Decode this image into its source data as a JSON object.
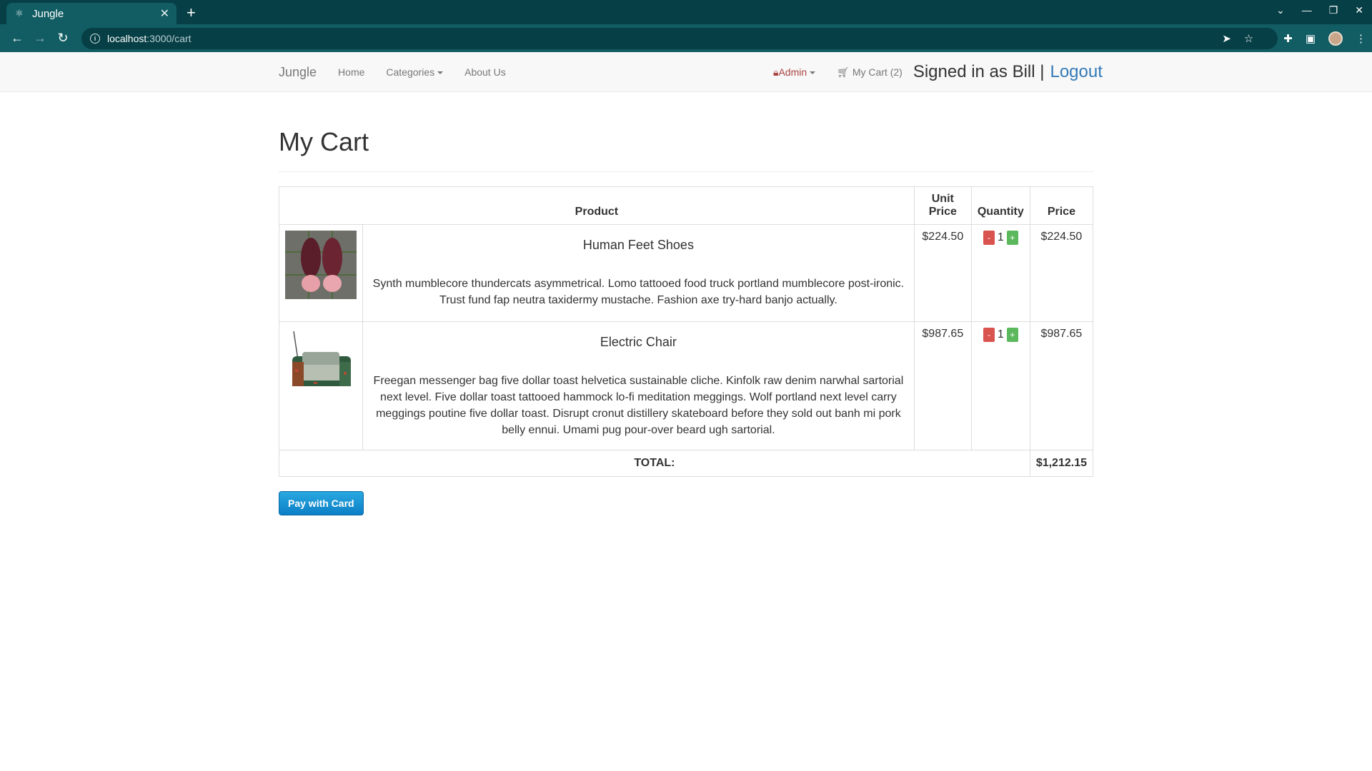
{
  "browser": {
    "tab_title": "Jungle",
    "url_host": "localhost",
    "url_path": ":3000/cart"
  },
  "navbar": {
    "brand": "Jungle",
    "links": [
      "Home",
      "Categories",
      "About Us"
    ],
    "admin": "Admin",
    "cart": "My Cart (2)",
    "signed_in": "Signed in as Bill |",
    "logout": "Logout"
  },
  "page": {
    "title": "My Cart"
  },
  "table": {
    "headers": {
      "product": "Product",
      "unit_price": "Unit Price",
      "quantity": "Quantity",
      "price": "Price"
    },
    "rows": [
      {
        "name": "Human Feet Shoes",
        "description": "Synth mumblecore thundercats asymmetrical. Lomo tattooed food truck portland mumblecore post-ironic. Trust fund fap neutra taxidermy mustache. Fashion axe try-hard banjo actually.",
        "unit_price": "$224.50",
        "quantity": "1",
        "price": "$224.50"
      },
      {
        "name": "Electric Chair",
        "description": "Freegan messenger bag five dollar toast helvetica sustainable cliche. Kinfolk raw denim narwhal sartorial next level. Five dollar toast tattooed hammock lo-fi meditation meggings. Wolf portland next level carry meggings poutine five dollar toast. Disrupt cronut distillery skateboard before they sold out banh mi pork belly ennui. Umami pug pour-over beard ugh sartorial.",
        "unit_price": "$987.65",
        "quantity": "1",
        "price": "$987.65"
      }
    ],
    "total_label": "TOTAL:",
    "total_value": "$1,212.15",
    "minus": "-",
    "plus": "+"
  },
  "pay_button": "Pay with Card",
  "colors": {
    "chrome_dark": "#063f45",
    "chrome_tab": "#115d63",
    "link_blue": "#337ab7",
    "admin_red": "#a94442",
    "minus_red": "#d9534f",
    "plus_green": "#5cb85c",
    "pay_blue": "#0c7fc6"
  }
}
